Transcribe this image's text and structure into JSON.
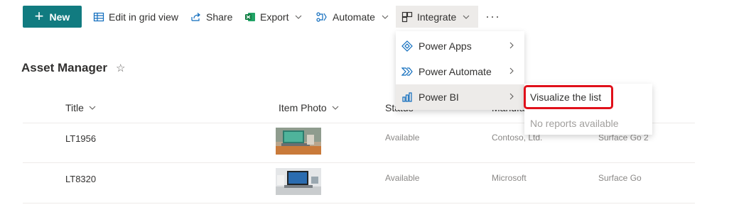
{
  "commandbar": {
    "new_label": "New",
    "edit_grid_label": "Edit in grid view",
    "share_label": "Share",
    "export_label": "Export",
    "automate_label": "Automate",
    "integrate_label": "Integrate",
    "more_label": "···"
  },
  "page": {
    "title": "Asset Manager"
  },
  "table": {
    "headers": {
      "title": "Title",
      "item_photo": "Item Photo",
      "status": "Status",
      "manufacturer": "Manufacturer"
    },
    "rows": [
      {
        "title": "LT1956",
        "status": "Available",
        "manufacturer": "Contoso, Ltd.",
        "model": "Surface Go 2"
      },
      {
        "title": "LT8320",
        "status": "Available",
        "manufacturer": "Microsoft",
        "model": "Surface Go"
      }
    ]
  },
  "integrate_menu": {
    "items": [
      {
        "label": "Power Apps",
        "icon": "power-apps-icon"
      },
      {
        "label": "Power Automate",
        "icon": "power-automate-icon"
      },
      {
        "label": "Power BI",
        "icon": "power-bi-icon"
      }
    ]
  },
  "powerbi_submenu": {
    "visualize_label": "Visualize the list",
    "no_reports_label": "No reports available"
  },
  "colors": {
    "accent": "#117b80",
    "highlight": "#e0101a"
  }
}
